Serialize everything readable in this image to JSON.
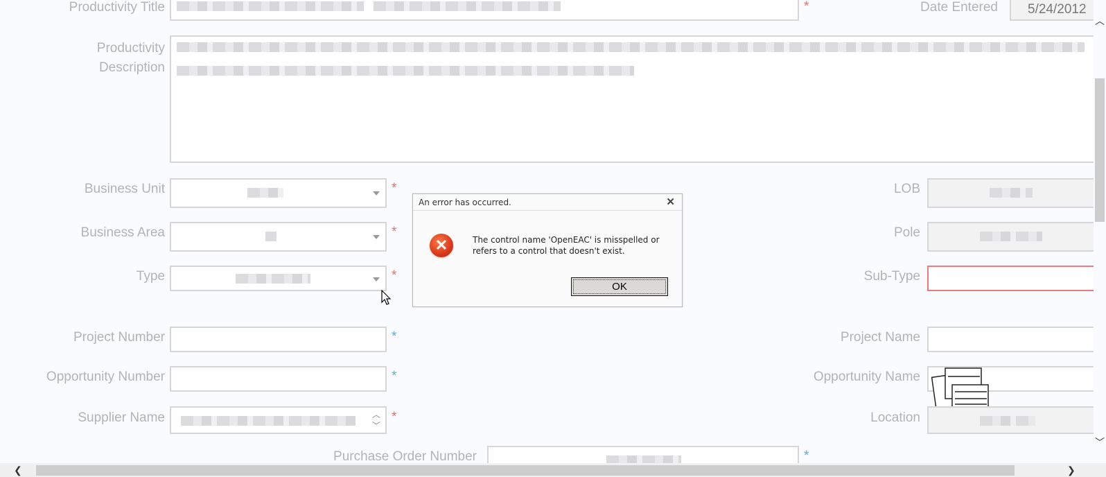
{
  "fields": {
    "productivity_title": "Productivity Title",
    "date_entered": "Date Entered",
    "date_value": "5/24/2012",
    "productivity_description": "Productivity\nDescription",
    "business_unit": "Business Unit",
    "business_area": "Business Area",
    "type": "Type",
    "lob": "LOB",
    "pole": "Pole",
    "sub_type": "Sub-Type",
    "project_number": "Project Number",
    "project_name": "Project Name",
    "opportunity_number": "Opportunity Number",
    "opportunity_name": "Opportunity Name",
    "supplier_name": "Supplier Name",
    "location": "Location",
    "purchase_order_number": "Purchase Order Number"
  },
  "required_marker": "*",
  "dialog": {
    "title": "An error has occurred.",
    "close": "✕",
    "message": "The control name 'OpenEAC' is misspelled or refers to a control that doesn't exist.",
    "ok_label": "OK",
    "icon": "error-icon"
  },
  "scrollbars": {
    "left_arrow": "❮",
    "right_arrow": "❯",
    "up_arrow": "︿",
    "down_arrow": "﹀"
  },
  "colors": {
    "required_red": "#e07474",
    "required_blue": "#65a9d6",
    "error_border": "#ee7b7b"
  }
}
